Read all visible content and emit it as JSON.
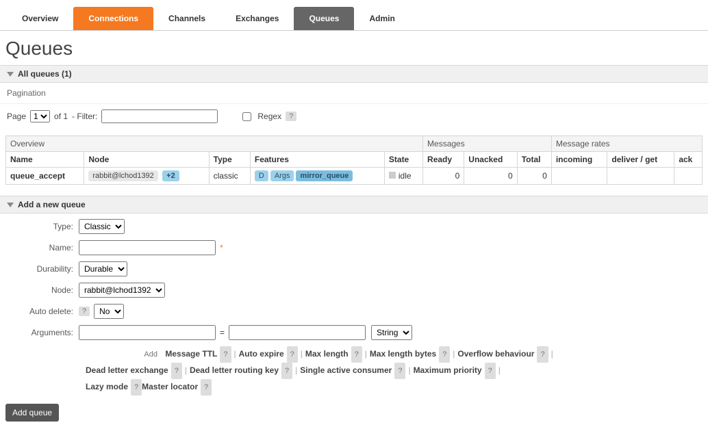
{
  "nav": {
    "items": [
      {
        "label": "Overview",
        "state": "normal"
      },
      {
        "label": "Connections",
        "state": "orange"
      },
      {
        "label": "Channels",
        "state": "normal"
      },
      {
        "label": "Exchanges",
        "state": "normal"
      },
      {
        "label": "Queues",
        "state": "grey"
      },
      {
        "label": "Admin",
        "state": "normal"
      }
    ]
  },
  "page_title": "Queues",
  "section_all": {
    "label": "All queues (1)"
  },
  "pagination_label": "Pagination",
  "pager": {
    "page_label": "Page",
    "page_value": "1",
    "of_total_label": "of 1",
    "filter_label": "- Filter:",
    "filter_value": "",
    "regex_label": "Regex",
    "regex_help": "?"
  },
  "table": {
    "group_headers": [
      "Overview",
      "Messages",
      "Message rates"
    ],
    "columns": [
      "Name",
      "Node",
      "Type",
      "Features",
      "State",
      "Ready",
      "Unacked",
      "Total",
      "incoming",
      "deliver / get",
      "ack"
    ],
    "rows": [
      {
        "name": "queue_accept",
        "node": "rabbit@lchod1392",
        "node_extra": "+2",
        "type": "classic",
        "features": [
          "D",
          "Args",
          "mirror_queue"
        ],
        "state": "idle",
        "ready": "0",
        "unacked": "0",
        "total": "0",
        "incoming": "",
        "deliver_get": "",
        "ack": ""
      }
    ]
  },
  "section_add": {
    "label": "Add a new queue"
  },
  "form": {
    "type": {
      "label": "Type:",
      "value": "Classic"
    },
    "name": {
      "label": "Name:",
      "value": ""
    },
    "durability": {
      "label": "Durability:",
      "value": "Durable"
    },
    "node": {
      "label": "Node:",
      "value": "rabbit@lchod1392"
    },
    "auto_delete": {
      "label": "Auto delete:",
      "value": "No",
      "help": "?"
    },
    "arguments": {
      "label": "Arguments:",
      "key": "",
      "eq": "=",
      "val": "",
      "type_value": "String"
    },
    "add_hint": "Add",
    "shortcuts": [
      "Message TTL",
      "Auto expire",
      "Max length",
      "Max length bytes",
      "Overflow behaviour",
      "Dead letter exchange",
      "Dead letter routing key",
      "Single active consumer",
      "Maximum priority",
      "Lazy mode",
      "Master locator"
    ],
    "help": "?",
    "submit": "Add queue"
  }
}
